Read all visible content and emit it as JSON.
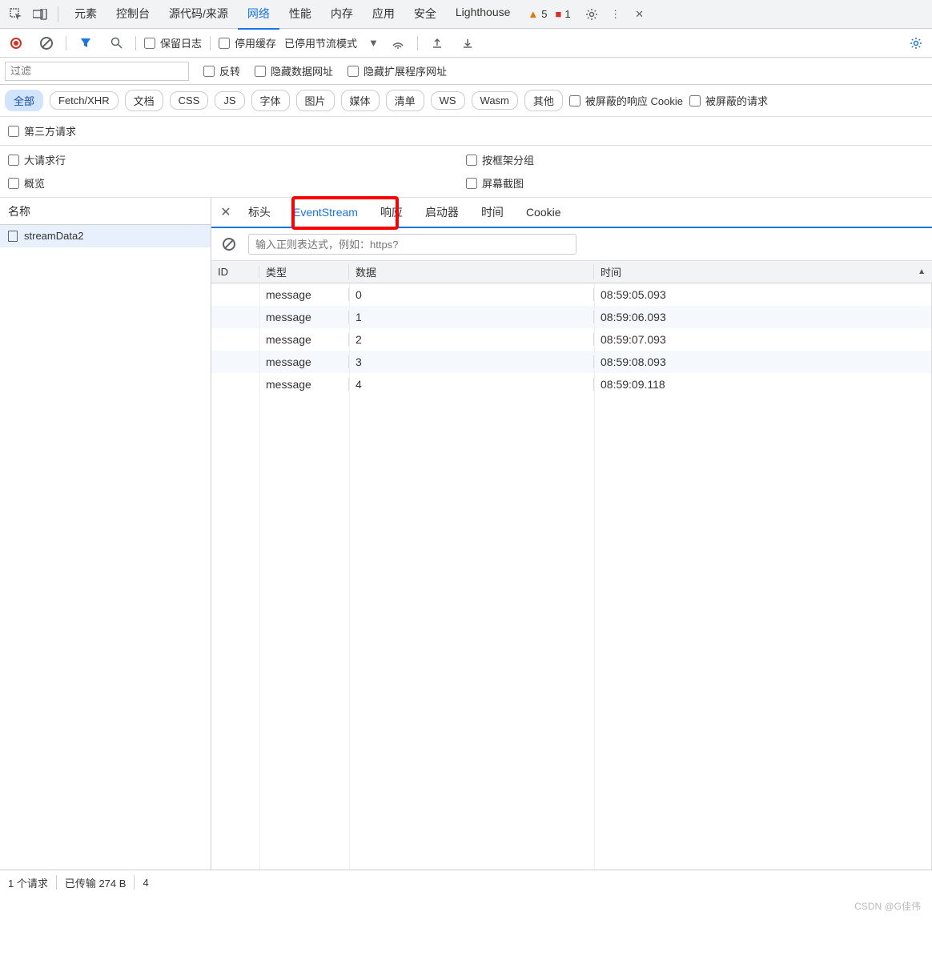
{
  "topTabs": [
    "元素",
    "控制台",
    "源代码/来源",
    "网络",
    "性能",
    "内存",
    "应用",
    "安全",
    "Lighthouse"
  ],
  "topActive": "网络",
  "warnings": {
    "warnCount": "5",
    "errCount": "1"
  },
  "toolbar2": {
    "preserveLog": "保留日志",
    "disableCache": "停用缓存",
    "throttling": "已停用节流模式"
  },
  "filterbar": {
    "filterPlaceholder": "过滤",
    "invert": "反转",
    "hideDataUrls": "隐藏数据网址",
    "hideExtUrls": "隐藏扩展程序网址"
  },
  "typePills": [
    "全部",
    "Fetch/XHR",
    "文档",
    "CSS",
    "JS",
    "字体",
    "图片",
    "媒体",
    "清单",
    "WS",
    "Wasm",
    "其他"
  ],
  "typeActive": "全部",
  "typeChecks": {
    "blockedCookies": "被屏蔽的响应 Cookie",
    "blockedRequests": "被屏蔽的请求",
    "thirdParty": "第三方请求"
  },
  "options": {
    "largeRows": "大请求行",
    "groupByFrame": "按框架分组",
    "overview": "概览",
    "screenshots": "屏幕截图"
  },
  "leftHeader": "名称",
  "requestName": "streamData2",
  "detailTabs": [
    "标头",
    "EventStream",
    "响应",
    "启动器",
    "时间",
    "Cookie"
  ],
  "detailActive": "EventStream",
  "regexPlaceholder": "输入正则表达式，例如：https?",
  "gridHeaders": {
    "id": "ID",
    "type": "类型",
    "data": "数据",
    "time": "时间"
  },
  "events": [
    {
      "id": "",
      "type": "message",
      "data": "0",
      "time": "08:59:05.093"
    },
    {
      "id": "",
      "type": "message",
      "data": "1",
      "time": "08:59:06.093"
    },
    {
      "id": "",
      "type": "message",
      "data": "2",
      "time": "08:59:07.093"
    },
    {
      "id": "",
      "type": "message",
      "data": "3",
      "time": "08:59:08.093"
    },
    {
      "id": "",
      "type": "message",
      "data": "4",
      "time": "08:59:09.118"
    }
  ],
  "status": {
    "requests": "1 个请求",
    "transferred": "已传输 274 B",
    "resources": "4"
  },
  "watermark": "CSDN @G佳伟"
}
